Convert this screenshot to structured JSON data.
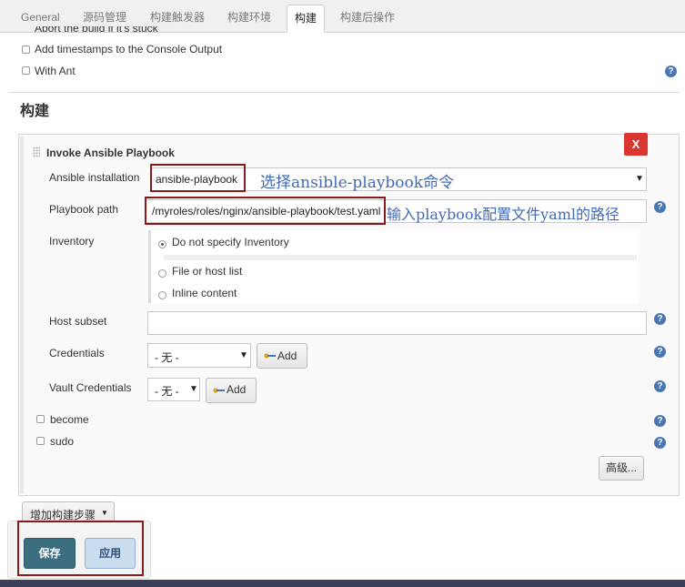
{
  "tabs": [
    {
      "label": "General"
    },
    {
      "label": "源码管理"
    },
    {
      "label": "构建触发器"
    },
    {
      "label": "构建环境"
    },
    {
      "label": "构建"
    },
    {
      "label": "构建后操作"
    }
  ],
  "active_tab": "构建",
  "env_options": {
    "cutoff_label": "Abort the build if it's stuck",
    "timestamps_label": "Add timestamps to the Console Output",
    "ant_label": "With Ant"
  },
  "build_section": {
    "title": "构建",
    "step_title": "Invoke Ansible Playbook",
    "delete_label": "X",
    "ansible_installation": {
      "label": "Ansible installation",
      "value": "ansible-playbook",
      "annotation": "选择ansible-playbook命令"
    },
    "playbook_path": {
      "label": "Playbook path",
      "value": "/myroles/roles/nginx/ansible-playbook/test.yaml",
      "annotation": "输入playbook配置文件yaml的路径"
    },
    "inventory": {
      "label": "Inventory",
      "options": [
        "Do not specify Inventory",
        "File or host list",
        "Inline content"
      ],
      "selected": "Do not specify Inventory"
    },
    "host_subset": {
      "label": "Host subset",
      "value": ""
    },
    "credentials": {
      "label": "Credentials",
      "value": "- 无 -",
      "add_label": "Add"
    },
    "vault_credentials": {
      "label": "Vault Credentials",
      "value": "- 无 -",
      "add_label": "Add"
    },
    "become_label": "become",
    "sudo_label": "sudo",
    "advanced_label": "高级..."
  },
  "add_step_label": "增加构建步骤",
  "footer": {
    "save_label": "保存",
    "apply_label": "应用"
  },
  "colors": {
    "annotation_text": "#4169b8",
    "annotation_box": "#8b1a1a",
    "save_button": "#3b6f80",
    "apply_button": "#c9ddef",
    "delete_button": "#d9362f",
    "help_icon": "#4a77b4"
  }
}
